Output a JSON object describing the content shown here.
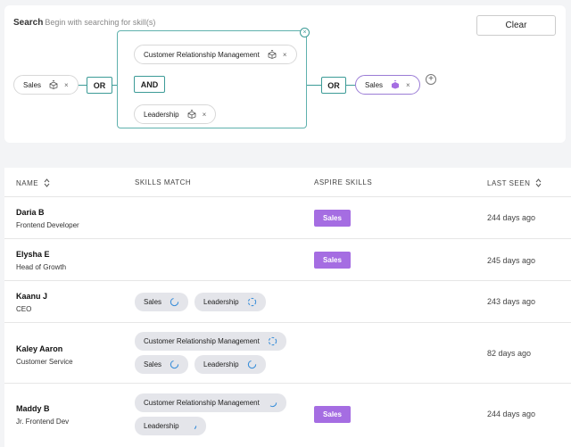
{
  "search": {
    "title": "Search",
    "hint": "Begin with searching for skill(s)",
    "clear_label": "Clear",
    "left_chip": "Sales",
    "op_or_1": "OR",
    "group": {
      "top_chip": "Customer Relationship Management",
      "op_and": "AND",
      "bottom_chip": "Leadership"
    },
    "op_or_2": "OR",
    "right_chip": "Sales",
    "remove_glyph": "×",
    "add_glyph": "+"
  },
  "table": {
    "headers": {
      "name": "NAME",
      "skills_match": "SKILLS MATCH",
      "aspire_skills": "ASPIRE SKILLS",
      "last_seen": "LAST SEEN"
    },
    "rows": [
      {
        "name": "Daria B",
        "title": "Frontend Developer",
        "skills": [],
        "aspire": "Sales",
        "last_seen": "244 days ago"
      },
      {
        "name": "Elysha E",
        "title": "Head of Growth",
        "skills": [],
        "aspire": "Sales",
        "last_seen": "245 days ago"
      },
      {
        "name": "Kaanu J",
        "title": "CEO",
        "skills": [
          "Sales",
          "Leadership"
        ],
        "aspire": "",
        "last_seen": "243 days ago"
      },
      {
        "name": "Kaley Aaron",
        "title": "Customer Service",
        "skills": [
          "Customer Relationship Management",
          "Sales",
          "Leadership"
        ],
        "aspire": "",
        "last_seen": "82 days ago"
      },
      {
        "name": "Maddy B",
        "title": "Jr. Frontend Dev",
        "skills": [
          "Customer Relationship Management",
          "Leadership"
        ],
        "aspire": "Sales",
        "last_seen": "244 days ago"
      }
    ]
  },
  "colors": {
    "accent_teal": "#3c9b97",
    "aspire_purple": "#a56de2",
    "spinner_blue": "#3b8fd9"
  }
}
